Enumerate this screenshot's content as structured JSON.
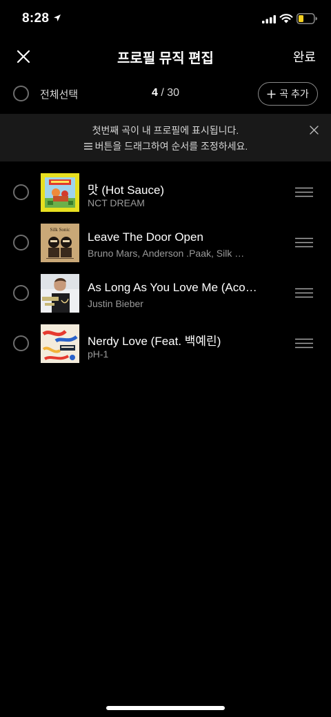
{
  "status_bar": {
    "time": "8:28"
  },
  "header": {
    "title": "프로필 뮤직 편집",
    "done_label": "완료"
  },
  "selection": {
    "select_all_label": "전체선택",
    "selected_count": "4",
    "count_separator": " / ",
    "total_count": "30",
    "add_song_label": "곡 추가"
  },
  "notice": {
    "line1": "첫번째 곡이 내 프로필에 표시됩니다.",
    "line2": "버튼을 드래그하여 순서를 조정하세요."
  },
  "songs": [
    {
      "title": "맛 (Hot Sauce)",
      "artist": "NCT DREAM"
    },
    {
      "title": "Leave The Door Open",
      "artist": "Bruno Mars, Anderson .Paak, Silk Sonic"
    },
    {
      "title": "As Long As You Love Me (Acoustic Version)",
      "artist": "Justin Bieber"
    },
    {
      "title": "Nerdy Love (Feat. 백예린)",
      "artist": "pH-1"
    }
  ],
  "album_art_text": {
    "silk_sonic": "Silk Sonic"
  },
  "colors": {
    "background": "#000000",
    "notice_bg": "#191919",
    "muted_text": "#9a9a9a",
    "radio_border": "#6e6e6e",
    "battery_fill": "#f5d020"
  }
}
